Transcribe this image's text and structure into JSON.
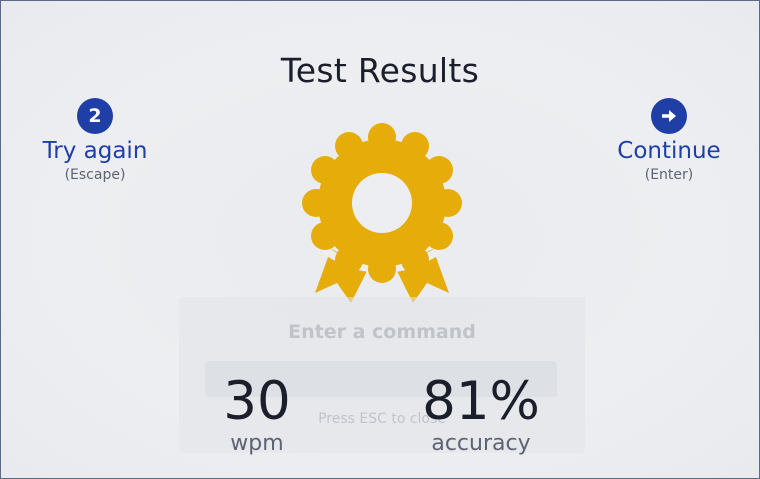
{
  "title": "Test Results",
  "actions": {
    "try_again": {
      "badge": "2",
      "label": "Try again",
      "hint": "(Escape)"
    },
    "continue": {
      "badge_icon": "arrow-right-icon",
      "label": "Continue",
      "hint": "(Enter)"
    }
  },
  "medal": {
    "icon": "award-ribbon-icon",
    "color": "#e6ad0a"
  },
  "command_palette": {
    "title": "Enter a command",
    "placeholder": "",
    "hint": "Press ESC to close"
  },
  "stats": {
    "wpm": {
      "value": "30",
      "label": "wpm"
    },
    "accuracy": {
      "value": "81%",
      "label": "accuracy"
    }
  },
  "colors": {
    "accent": "#1f3fa6",
    "background": "#eceef1",
    "text": "#1a1f2b",
    "muted": "#5c6474"
  }
}
